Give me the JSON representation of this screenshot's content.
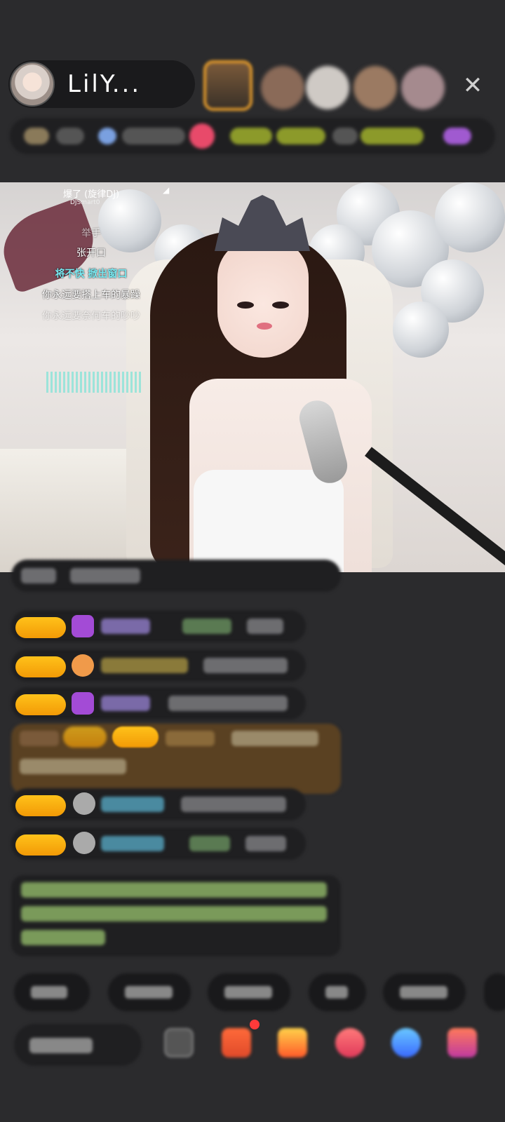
{
  "header": {
    "host_name": "LilY...",
    "close_icon": "close-icon"
  },
  "video": {
    "lyrics": {
      "song_title": "爆了 (旋律DJ)",
      "song_artist": "DJSmart0",
      "lines": [
        {
          "text": "举手",
          "style": "normal"
        },
        {
          "text": "张开口",
          "style": "normal"
        },
        {
          "text": "将不快 掀出窗口",
          "style": "current"
        },
        {
          "text": "你永远要搭上车的暴躁",
          "style": "normal"
        },
        {
          "text": "你永远要奈何车的吵吵",
          "style": "fade"
        }
      ]
    }
  },
  "chat": {
    "colors": {
      "badge": "#f6ac0c",
      "highlight_bg": "#5a4122",
      "bubble_bg": "#1f1f21"
    }
  },
  "bottom_bar": {
    "icons": [
      "smile-icon",
      "gift-box-icon",
      "red-envelope-icon",
      "game-icon",
      "chat-icon",
      "mall-icon"
    ]
  }
}
